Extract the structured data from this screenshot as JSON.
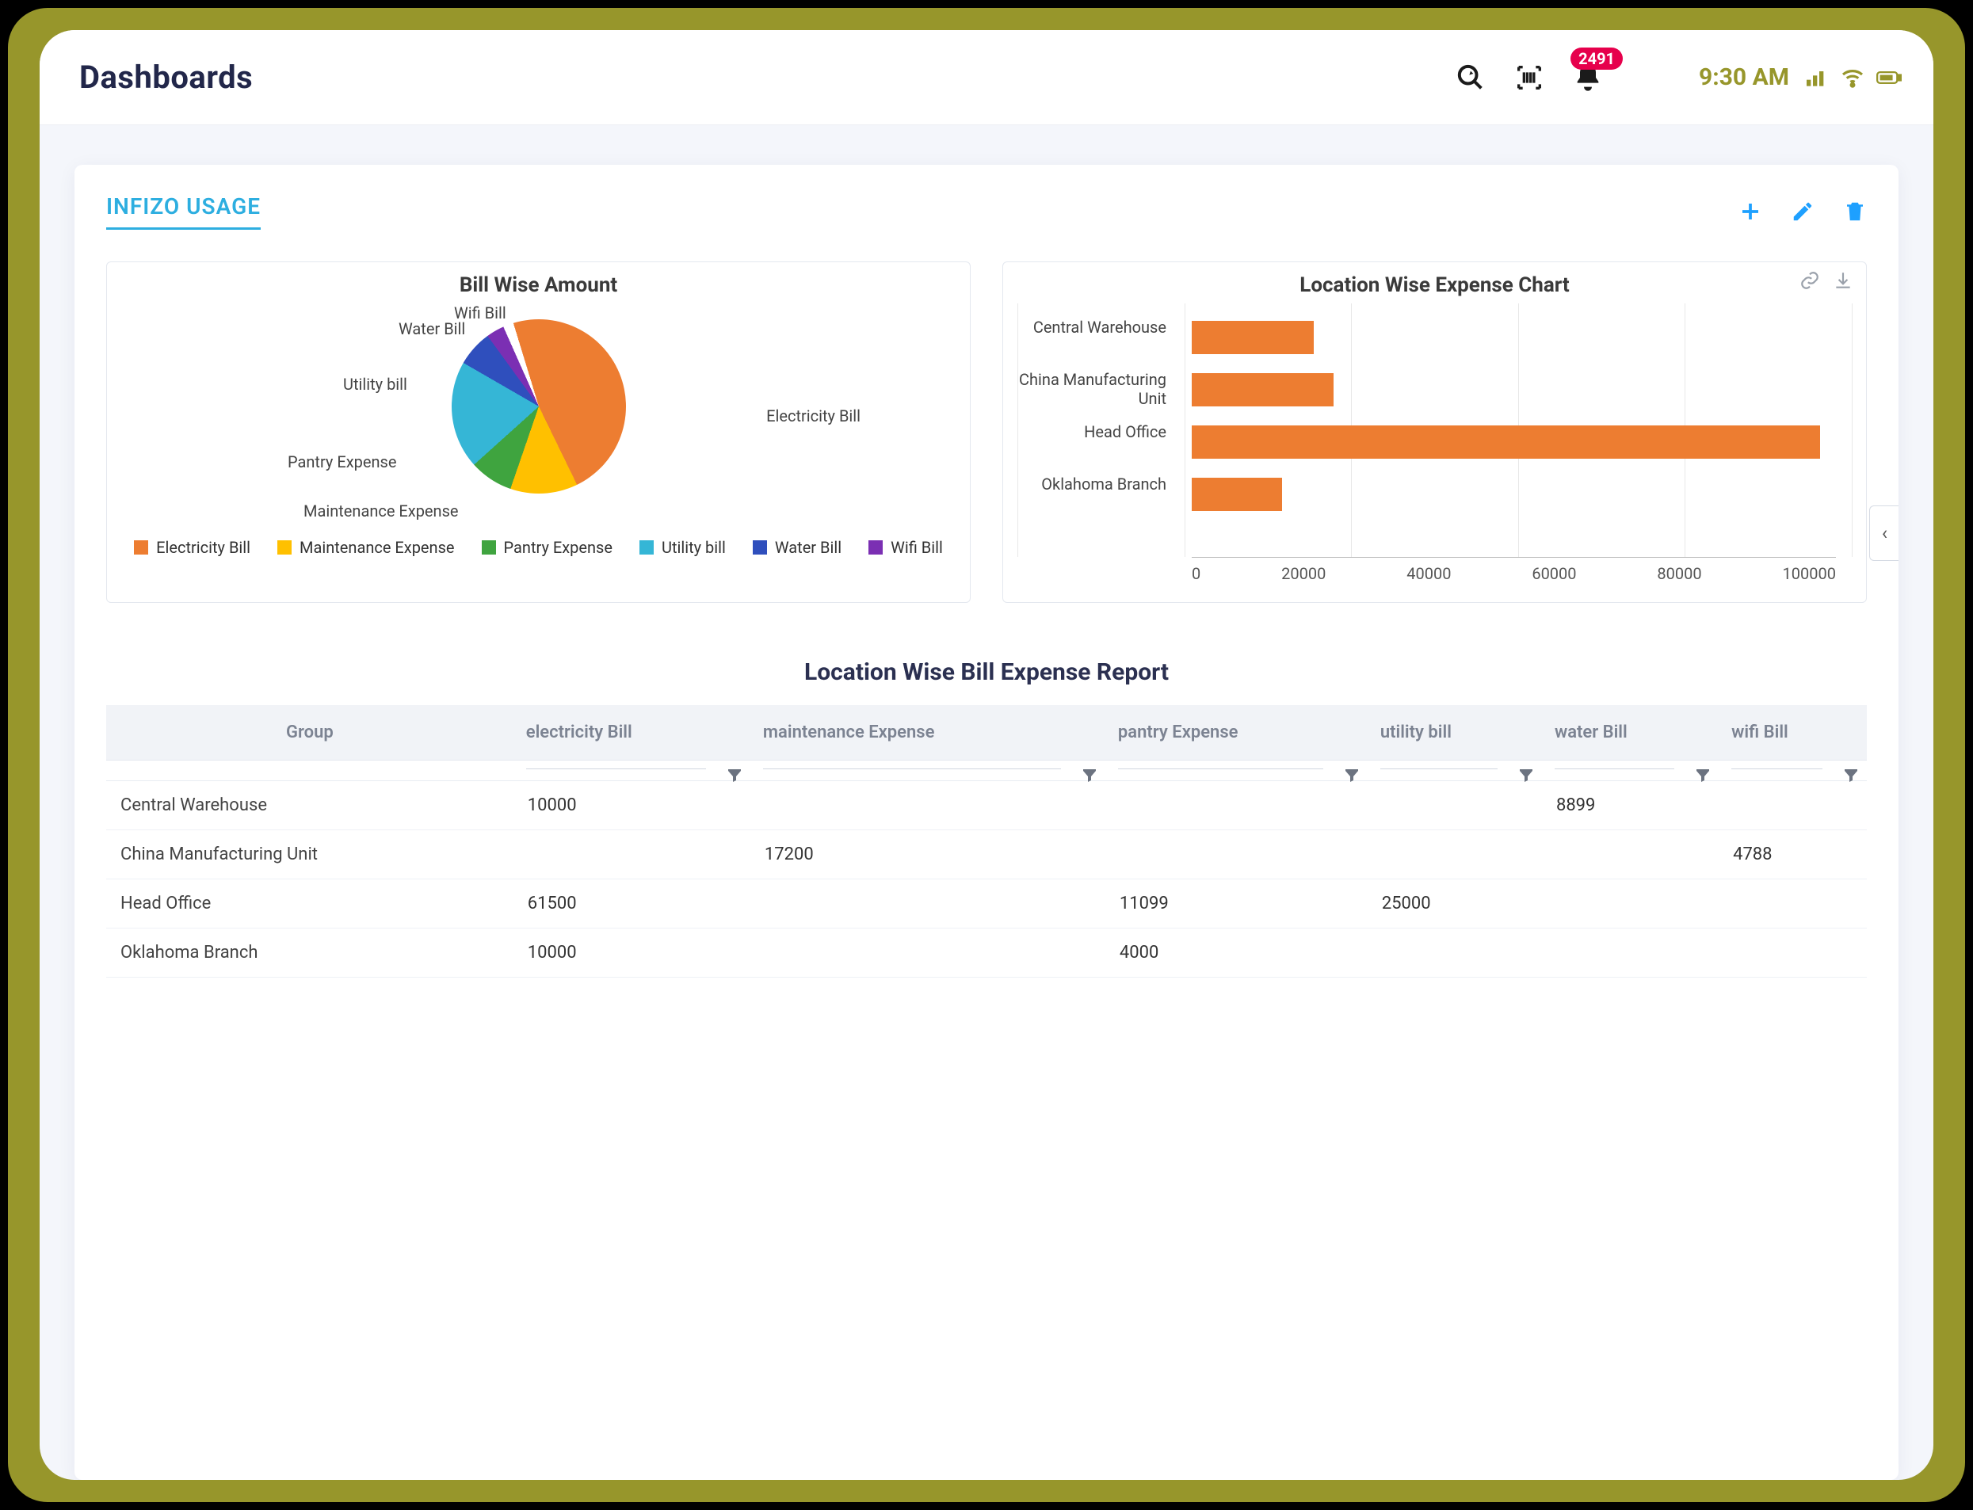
{
  "header": {
    "title": "Dashboards",
    "notification_count": "2491",
    "clock": "9:30 AM"
  },
  "tab": {
    "label": "INFIZO USAGE"
  },
  "side_tab_glyph": "‹",
  "colors": {
    "electricity": "#ed7d31",
    "maintenance": "#ffc000",
    "pantry": "#3fa43f",
    "utility": "#35b6d6",
    "water": "#2f4fbd",
    "wifi": "#7b2fb3",
    "accent_blue": "#1ea0ff",
    "brand_olive": "#97962b",
    "badge_pink": "#e6004c"
  },
  "chart_data": [
    {
      "type": "pie",
      "title": "Bill Wise Amount",
      "series": [
        {
          "name": "Electricity Bill",
          "value": 81500
        },
        {
          "name": "Maintenance Expense",
          "value": 17200
        },
        {
          "name": "Pantry Expense",
          "value": 15099
        },
        {
          "name": "Utility bill",
          "value": 25000
        },
        {
          "name": "Water Bill",
          "value": 8899
        },
        {
          "name": "Wifi Bill",
          "value": 4788
        }
      ],
      "legend": [
        "Electricity Bill",
        "Maintenance Expense",
        "Pantry Expense",
        "Utility bill",
        "Water Bill",
        "Wifi Bill"
      ]
    },
    {
      "type": "bar",
      "orientation": "horizontal",
      "title": "Location Wise Expense Chart",
      "categories": [
        "Central Warehouse",
        "China Manufacturing Unit",
        "Head Office",
        "Oklahoma Branch"
      ],
      "values": [
        18899,
        21988,
        97599,
        14000
      ],
      "xlim": [
        0,
        100000
      ],
      "xticks": [
        0,
        20000,
        40000,
        60000,
        80000,
        100000
      ],
      "xlabel": "",
      "ylabel": ""
    }
  ],
  "report": {
    "title": "Location Wise Bill Expense Report",
    "columns": [
      "Group",
      "electricity Bill",
      "maintenance Expense",
      "pantry Expense",
      "utility bill",
      "water Bill",
      "wifi Bill"
    ],
    "rows": [
      {
        "group": "Central Warehouse",
        "electricity": "10000",
        "maintenance": "",
        "pantry": "",
        "utility": "",
        "water": "8899",
        "wifi": ""
      },
      {
        "group": "China Manufacturing Unit",
        "electricity": "",
        "maintenance": "17200",
        "pantry": "",
        "utility": "",
        "water": "",
        "wifi": "4788"
      },
      {
        "group": "Head Office",
        "electricity": "61500",
        "maintenance": "",
        "pantry": "11099",
        "utility": "25000",
        "water": "",
        "wifi": ""
      },
      {
        "group": "Oklahoma Branch",
        "electricity": "10000",
        "maintenance": "",
        "pantry": "4000",
        "utility": "",
        "water": "",
        "wifi": ""
      }
    ]
  }
}
